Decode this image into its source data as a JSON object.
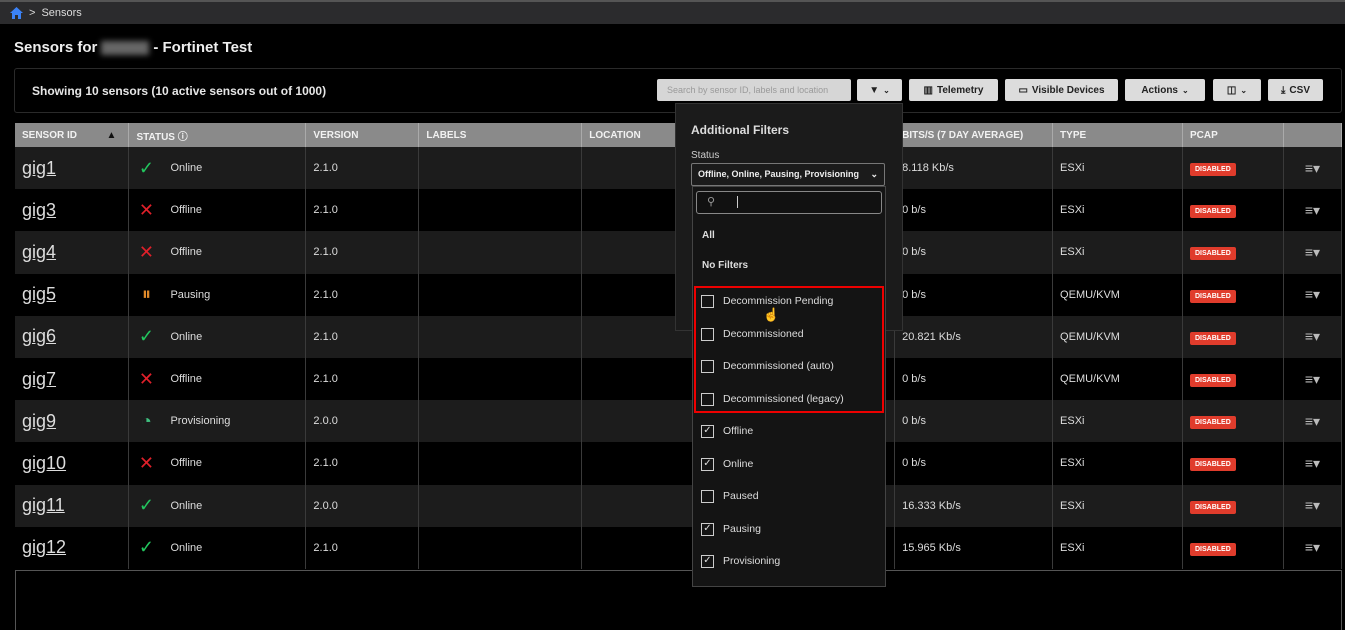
{
  "breadcrumb": {
    "sep": ">",
    "current": "Sensors"
  },
  "page_title_prefix": "Sensors for",
  "page_title_suffix": "- Fortinet Test",
  "summary": "Showing 10 sensors (10 active sensors out of 1000)",
  "toolbar": {
    "search_placeholder": "Search by sensor ID, labels and location",
    "telemetry": "Telemetry",
    "visible_devices": "Visible Devices",
    "actions": "Actions",
    "csv": "CSV"
  },
  "columns": [
    "SENSOR ID",
    "STATUS",
    "VERSION",
    "LABELS",
    "LOCATION",
    "BITS/S (7 DAY AVERAGE)",
    "TYPE",
    "PCAP"
  ],
  "rows": [
    {
      "id": "gig1",
      "status": "Online",
      "version": "2.1.0",
      "bits": "8.118 Kb/s",
      "type": "ESXi",
      "pcap": "DISABLED"
    },
    {
      "id": "gig3",
      "status": "Offline",
      "version": "2.1.0",
      "bits": "0 b/s",
      "type": "ESXi",
      "pcap": "DISABLED"
    },
    {
      "id": "gig4",
      "status": "Offline",
      "version": "2.1.0",
      "bits": "0 b/s",
      "type": "ESXi",
      "pcap": "DISABLED"
    },
    {
      "id": "gig5",
      "status": "Pausing",
      "version": "2.1.0",
      "bits": "0 b/s",
      "type": "QEMU/KVM",
      "pcap": "DISABLED"
    },
    {
      "id": "gig6",
      "status": "Online",
      "version": "2.1.0",
      "bits": "20.821 Kb/s",
      "type": "QEMU/KVM",
      "pcap": "DISABLED"
    },
    {
      "id": "gig7",
      "status": "Offline",
      "version": "2.1.0",
      "bits": "0 b/s",
      "type": "QEMU/KVM",
      "pcap": "DISABLED"
    },
    {
      "id": "gig9",
      "status": "Provisioning",
      "version": "2.0.0",
      "bits": "0 b/s",
      "type": "ESXi",
      "pcap": "DISABLED"
    },
    {
      "id": "gig10",
      "status": "Offline",
      "version": "2.1.0",
      "bits": "0 b/s",
      "type": "ESXi",
      "pcap": "DISABLED"
    },
    {
      "id": "gig11",
      "status": "Online",
      "version": "2.0.0",
      "bits": "16.333 Kb/s",
      "type": "ESXi",
      "pcap": "DISABLED"
    },
    {
      "id": "gig12",
      "status": "Online",
      "version": "2.1.0",
      "bits": "15.965 Kb/s",
      "type": "ESXi",
      "pcap": "DISABLED"
    }
  ],
  "filters": {
    "title": "Additional Filters",
    "status_label": "Status",
    "selected": "Offline, Online, Pausing, Provisioning",
    "all": "All",
    "none": "No Filters",
    "options": [
      {
        "label": "Decommission Pending",
        "checked": false
      },
      {
        "label": "Decommissioned",
        "checked": false
      },
      {
        "label": "Decommissioned (auto)",
        "checked": false
      },
      {
        "label": "Decommissioned (legacy)",
        "checked": false
      },
      {
        "label": "Offline",
        "checked": true
      },
      {
        "label": "Online",
        "checked": true
      },
      {
        "label": "Paused",
        "checked": false
      },
      {
        "label": "Pausing",
        "checked": true
      },
      {
        "label": "Provisioning",
        "checked": true
      }
    ]
  },
  "colors": {
    "online": "#22c55e",
    "offline": "#e0202a",
    "pausing": "#e08a2a",
    "provisioning": "#3fbf7f",
    "badge": "#e03c2c",
    "highlight": "#ee0000"
  }
}
